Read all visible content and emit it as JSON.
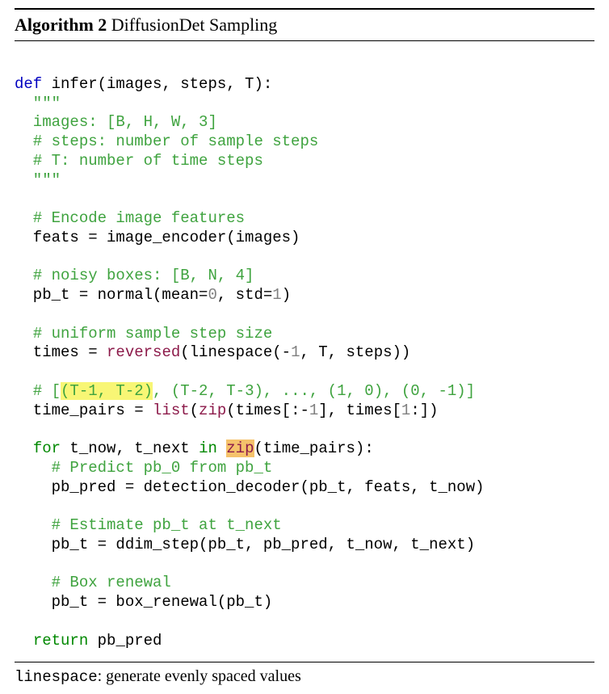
{
  "header": {
    "label": "Algorithm 2",
    "title": " DiffusionDet Sampling"
  },
  "code": {
    "l1_def": "def",
    "l1_rest": " infer(images, steps, T):",
    "l2": "  \"\"\"",
    "l3": "  images: [B, H, W, 3]",
    "l4": "  # steps: number of sample steps",
    "l5": "  # T: number of time steps",
    "l6": "  \"\"\"",
    "l8": "  # Encode image features",
    "l9": "  feats = image_encoder(images)",
    "l11": "  # noisy boxes: [B, N, 4]",
    "l12a": "  pb_t = normal(mean=",
    "l12n0": "0",
    "l12b": ", std=",
    "l12n1": "1",
    "l12c": ")",
    "l14": "  # uniform sample step size",
    "l15a": "  times = ",
    "l15rev": "reversed",
    "l15b": "(linespace(-",
    "l15n1": "1",
    "l15c": ", T, steps))",
    "l17a": "  # [",
    "l17hl": "(T-1, T-2)",
    "l17b": ", (T-2, T-3), ..., (1, 0), (0, -1)]",
    "l18a": "  time_pairs = ",
    "l18list": "list",
    "l18b": "(",
    "l18zip": "zip",
    "l18c": "(times[:-",
    "l18n1": "1",
    "l18d": "], times[",
    "l18n2": "1",
    "l18e": ":])",
    "l20a": "  ",
    "l20for": "for",
    "l20b": " t_now, t_next ",
    "l20in": "in",
    "l20c": " ",
    "l20zip": "zip",
    "l20d": "(time_pairs):",
    "l21": "    # Predict pb_0 from pb_t",
    "l22": "    pb_pred = detection_decoder(pb_t, feats, t_now)",
    "l24": "    # Estimate pb_t at t_next",
    "l25": "    pb_t = ddim_step(pb_t, pb_pred, t_now, t_next)",
    "l27": "    # Box renewal",
    "l28": "    pb_t = box_renewal(pb_t)",
    "l30a": "  ",
    "l30ret": "return",
    "l30b": " pb_pred"
  },
  "footnote": {
    "term": "linespace",
    "desc": ": generate evenly spaced values"
  }
}
